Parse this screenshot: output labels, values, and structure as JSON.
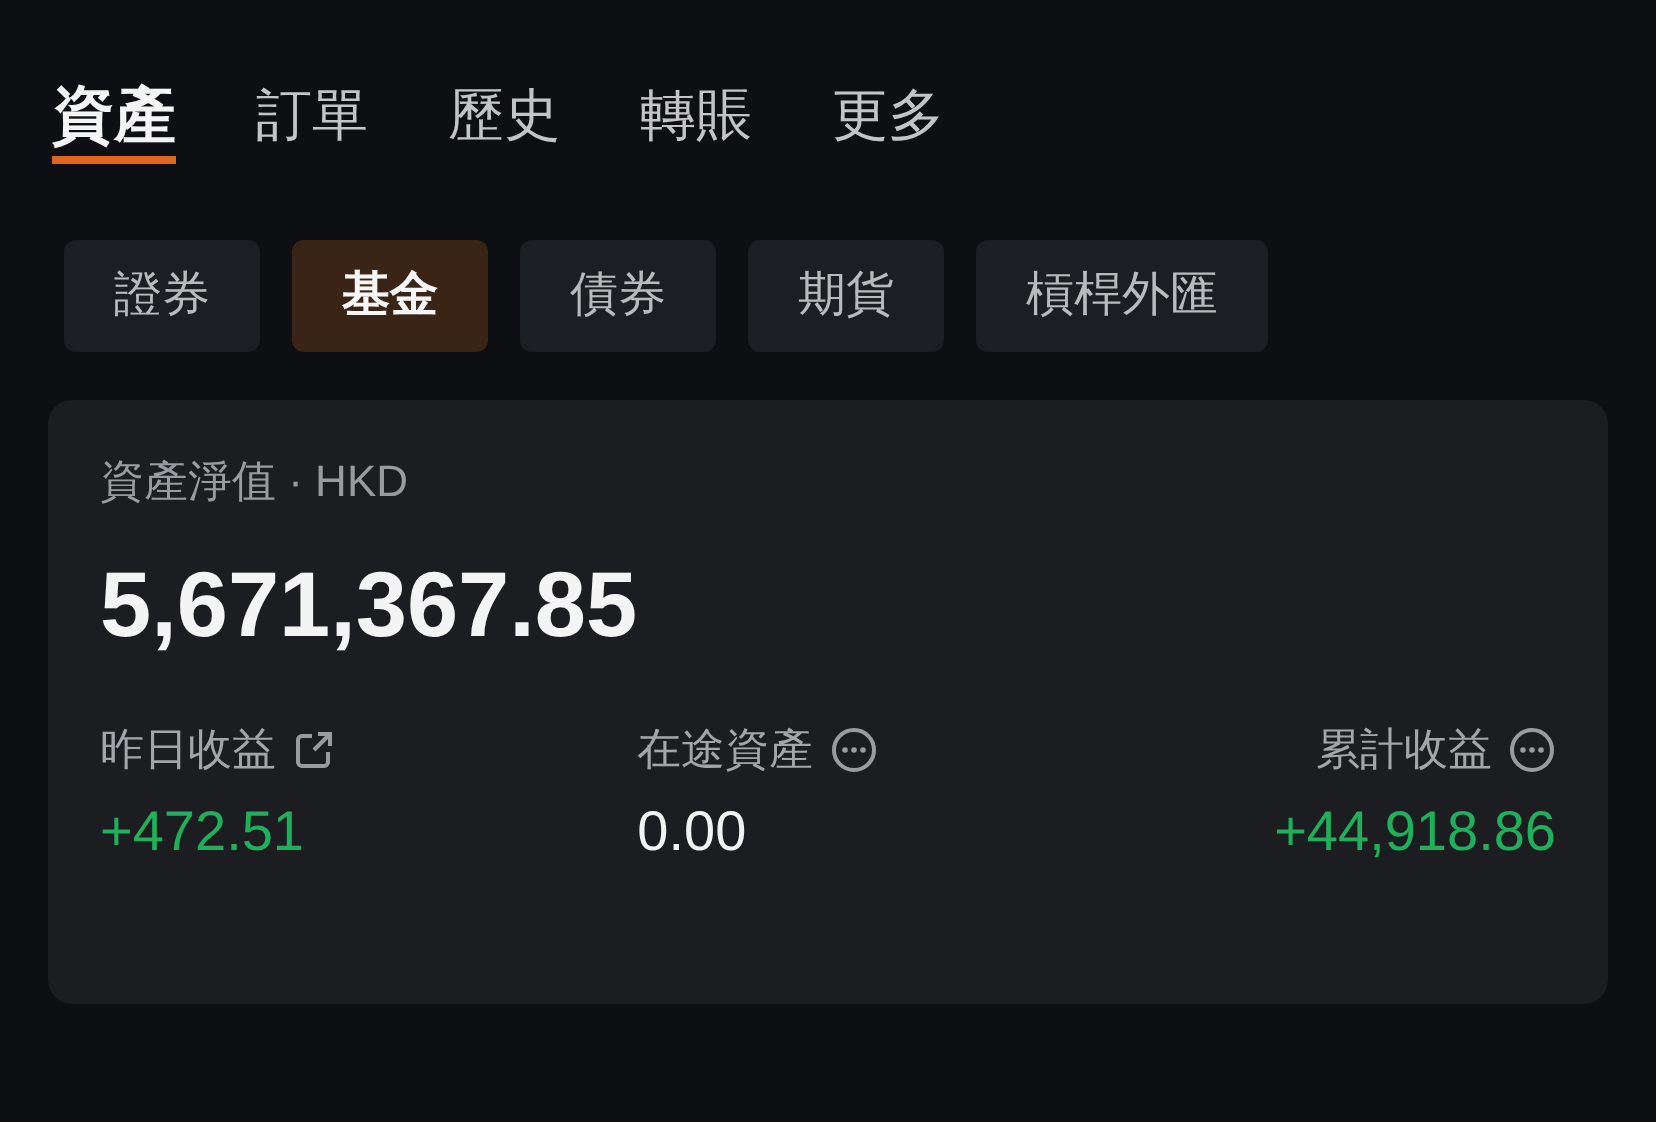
{
  "tabs": [
    {
      "label": "資產",
      "selected": true
    },
    {
      "label": "訂單",
      "selected": false
    },
    {
      "label": "歷史",
      "selected": false
    },
    {
      "label": "轉賬",
      "selected": false
    },
    {
      "label": "更多",
      "selected": false
    }
  ],
  "categories": [
    {
      "label": "證券",
      "selected": false
    },
    {
      "label": "基金",
      "selected": true
    },
    {
      "label": "債券",
      "selected": false
    },
    {
      "label": "期貨",
      "selected": false
    },
    {
      "label": "槓桿外匯",
      "selected": false
    }
  ],
  "summary": {
    "title": "資產淨值 · HKD",
    "net_value": "5,671,367.85",
    "stats": [
      {
        "label": "昨日收益",
        "kind": "share",
        "value": "+472.51",
        "color": "#20b05c"
      },
      {
        "label": "在途資產",
        "kind": "info",
        "value": "0.00",
        "color": "#f2f2f2"
      },
      {
        "label": "累計收益",
        "kind": "info",
        "value": "+44,918.86",
        "color": "#20b05c"
      }
    ]
  }
}
